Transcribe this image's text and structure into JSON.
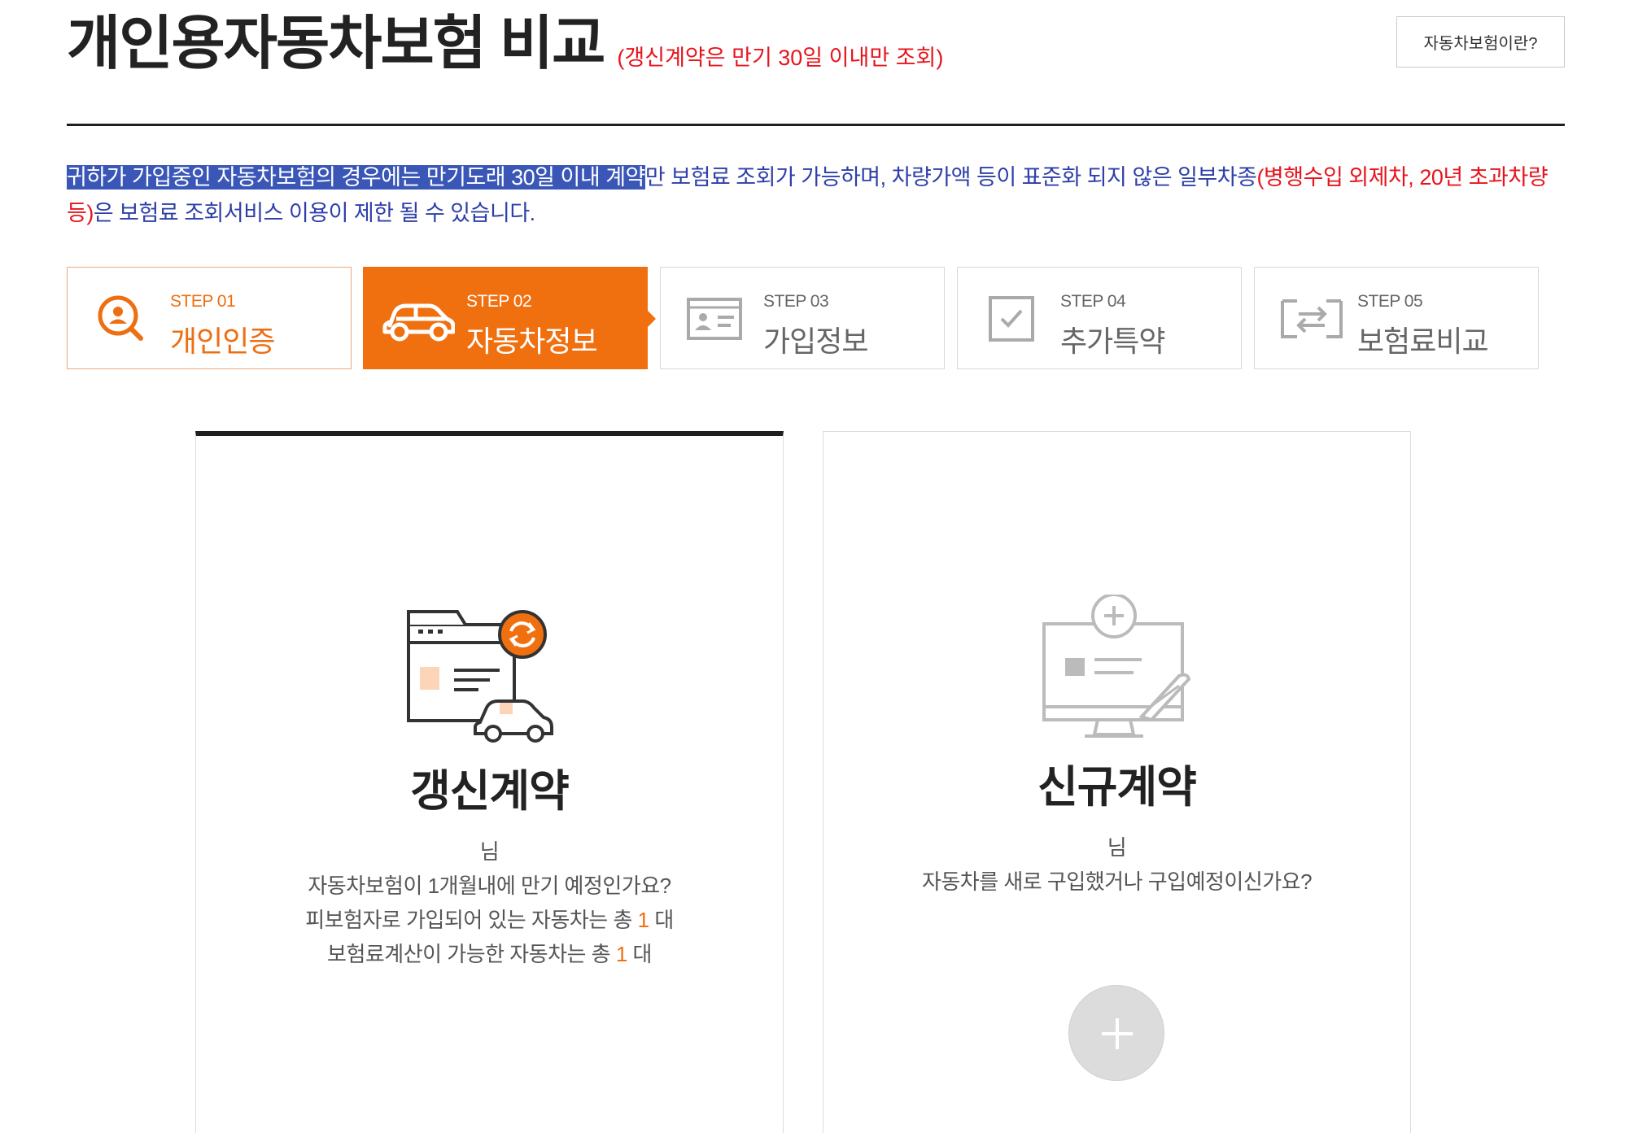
{
  "header": {
    "title": "개인용자동차보험 비교",
    "subtitle": "(갱신계약은 만기 30일 이내만 조회)",
    "help_button_label": "자동차보험이란?"
  },
  "notice": {
    "highlighted": "귀하가 가입중인 자동차보험의 경우에는 만기도래 30일 이내 계약",
    "text_main": "만 보험료 조회가 가능하며, 차량가액 등이 표준화 되지 않은 일부차종",
    "text_red": "(병행수입 외제차, 20년 초과차량 등)",
    "text_tail": "은 보험료 조회서비스 이용이 제한 될 수 있습니다."
  },
  "steps": [
    {
      "num": "STEP 01",
      "label": "개인인증",
      "state": "done",
      "icon": "person-search-icon"
    },
    {
      "num": "STEP 02",
      "label": "자동차정보",
      "state": "active",
      "icon": "car-icon"
    },
    {
      "num": "STEP 03",
      "label": "가입정보",
      "state": "pending",
      "icon": "id-card-icon"
    },
    {
      "num": "STEP 04",
      "label": "추가특약",
      "state": "pending",
      "icon": "checkbox-icon"
    },
    {
      "num": "STEP 05",
      "label": "보험료비교",
      "state": "pending",
      "icon": "compare-icon"
    }
  ],
  "renewal_card": {
    "title": "갱신계약",
    "user_suffix": "님",
    "line1": "자동차보험이 1개월내에 만기 예정인가요?",
    "line2_prefix": "피보험자로 가입되어 있는 자동차는 총",
    "line2_count": "1",
    "line2_suffix": "대",
    "line3_prefix": "보험료계산이 가능한 자동차는 총",
    "line3_count": "1",
    "line3_suffix": "대",
    "illustration": "renewal-document-car-icon"
  },
  "new_card": {
    "title": "신규계약",
    "user_suffix": "님",
    "line1": "자동차를 새로 구입했거나 구입예정이신가요?",
    "illustration": "new-contract-document-icon",
    "add_icon": "plus-icon"
  },
  "colors": {
    "accent": "#f07010",
    "notice_blue": "#2e3fa8",
    "alert_red": "#e8141d",
    "highlight": "#3a57b8"
  }
}
